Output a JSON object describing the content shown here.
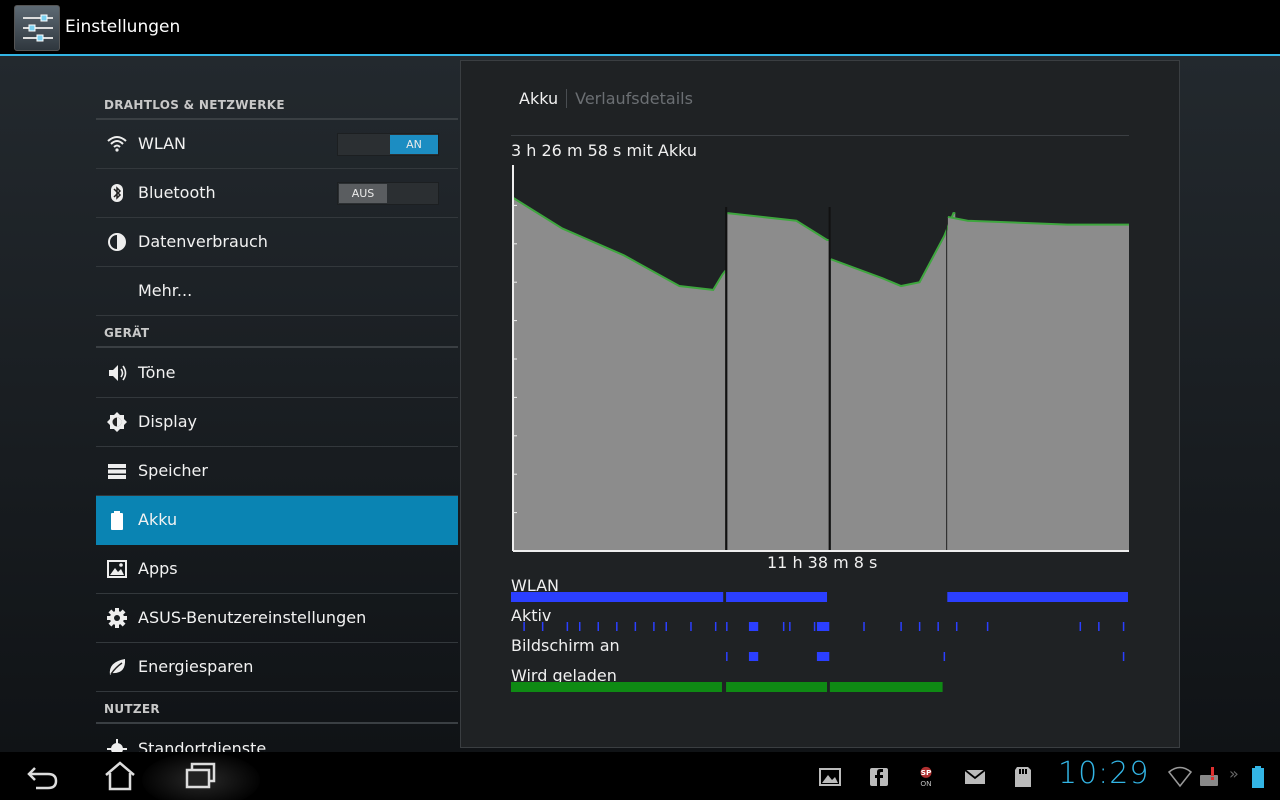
{
  "app": {
    "title": "Einstellungen"
  },
  "sidebar": {
    "sections": [
      {
        "header": "DRAHTLOS & NETZWERKE"
      },
      {
        "header": "GERÄT"
      },
      {
        "header": "NUTZER"
      }
    ],
    "items": [
      {
        "label": "WLAN",
        "icon": "wifi-icon",
        "toggle": "AN"
      },
      {
        "label": "Bluetooth",
        "icon": "bluetooth-icon",
        "toggle": "AUS"
      },
      {
        "label": "Datenverbrauch",
        "icon": "data-usage-icon"
      },
      {
        "label": "Mehr...",
        "icon": ""
      },
      {
        "label": "Töne",
        "icon": "speaker-icon"
      },
      {
        "label": "Display",
        "icon": "brightness-icon"
      },
      {
        "label": "Speicher",
        "icon": "storage-icon"
      },
      {
        "label": "Akku",
        "icon": "battery-icon",
        "selected": true
      },
      {
        "label": "Apps",
        "icon": "apps-icon"
      },
      {
        "label": "ASUS-Benutzereinstellungen",
        "icon": "gear-icon"
      },
      {
        "label": "Energiesparen",
        "icon": "leaf-icon"
      },
      {
        "label": "Standortdienste",
        "icon": "location-icon"
      }
    ]
  },
  "panel": {
    "tabs": [
      {
        "label": "Akku",
        "active": true
      },
      {
        "label": "Verlaufsdetails",
        "active": false
      }
    ],
    "graph_title": "3 h 26 m 58 s mit Akku",
    "graph_xlabel": "11 h 38 m 8 s",
    "lanes": [
      {
        "label": "WLAN"
      },
      {
        "label": "Aktiv"
      },
      {
        "label": "Bildschirm an"
      },
      {
        "label": "Wird geladen"
      }
    ]
  },
  "chart_data": {
    "type": "area",
    "title": "3 h 26 m 58 s mit Akku",
    "xlabel": "11 h 38 m 8 s",
    "ylabel": "",
    "x_unit": "fraction of total duration",
    "y_unit": "battery level (%)",
    "ylim": [
      0,
      100
    ],
    "xlim": [
      0,
      1
    ],
    "segments": [
      {
        "x": [
          0.0,
          0.08,
          0.18,
          0.27,
          0.325,
          0.34,
          0.345
        ],
        "y": [
          92,
          84,
          77,
          69,
          68,
          72,
          73
        ]
      },
      {
        "x": [
          0.348,
          0.46,
          0.51,
          0.513
        ],
        "y": [
          88,
          86,
          81,
          81
        ]
      },
      {
        "x": [
          0.516,
          0.6,
          0.63,
          0.66,
          0.7,
          0.715,
          0.718
        ],
        "y": [
          76,
          71,
          69,
          70,
          82,
          88,
          88
        ]
      },
      {
        "x": [
          0.706,
          0.738,
          0.9,
          1.0
        ],
        "y": [
          87,
          86,
          85,
          85
        ]
      }
    ],
    "lanes": [
      {
        "name": "WLAN",
        "color": "#2b3fff",
        "intervals": [
          [
            0.0,
            0.345
          ],
          [
            0.348,
            0.513
          ],
          [
            0.706,
            1.0
          ]
        ]
      },
      {
        "name": "Aktiv",
        "color": "#2b3fff",
        "ticks": [
          0.02,
          0.05,
          0.09,
          0.11,
          0.14,
          0.17,
          0.2,
          0.23,
          0.25,
          0.29,
          0.33,
          0.348,
          0.44,
          0.45,
          0.49,
          0.51,
          0.57,
          0.63,
          0.66,
          0.69,
          0.72,
          0.77,
          0.92,
          0.95,
          0.99
        ],
        "blocks": [
          [
            0.385,
            0.4
          ],
          [
            0.495,
            0.515
          ]
        ]
      },
      {
        "name": "Bildschirm an",
        "color": "#2b3fff",
        "ticks": [
          0.348,
          0.7,
          0.99
        ],
        "blocks": [
          [
            0.385,
            0.4
          ],
          [
            0.495,
            0.515
          ]
        ]
      },
      {
        "name": "Wird geladen",
        "color": "#0f8a14",
        "intervals": [
          [
            0.0,
            0.343
          ],
          [
            0.348,
            0.513
          ],
          [
            0.516,
            0.7
          ]
        ]
      }
    ],
    "grid": false,
    "legend": "none"
  },
  "system_bar": {
    "clock": "10:29",
    "notifications": [
      "gallery-icon",
      "facebook-icon",
      "sp-on-icon",
      "mail-icon",
      "sd-card-icon"
    ],
    "status": [
      "wifi-icon",
      "keyboard-alert-icon",
      "battery-icon"
    ],
    "nav": [
      "back-icon",
      "home-icon",
      "recent-apps-icon"
    ]
  },
  "colors": {
    "accent": "#33b5e5",
    "selected": "#0a84b3",
    "graph_fill": "#8c8c8c",
    "graph_line": "#3ea63e",
    "lane_blue": "#2b3fff",
    "lane_green": "#0f8a14"
  }
}
